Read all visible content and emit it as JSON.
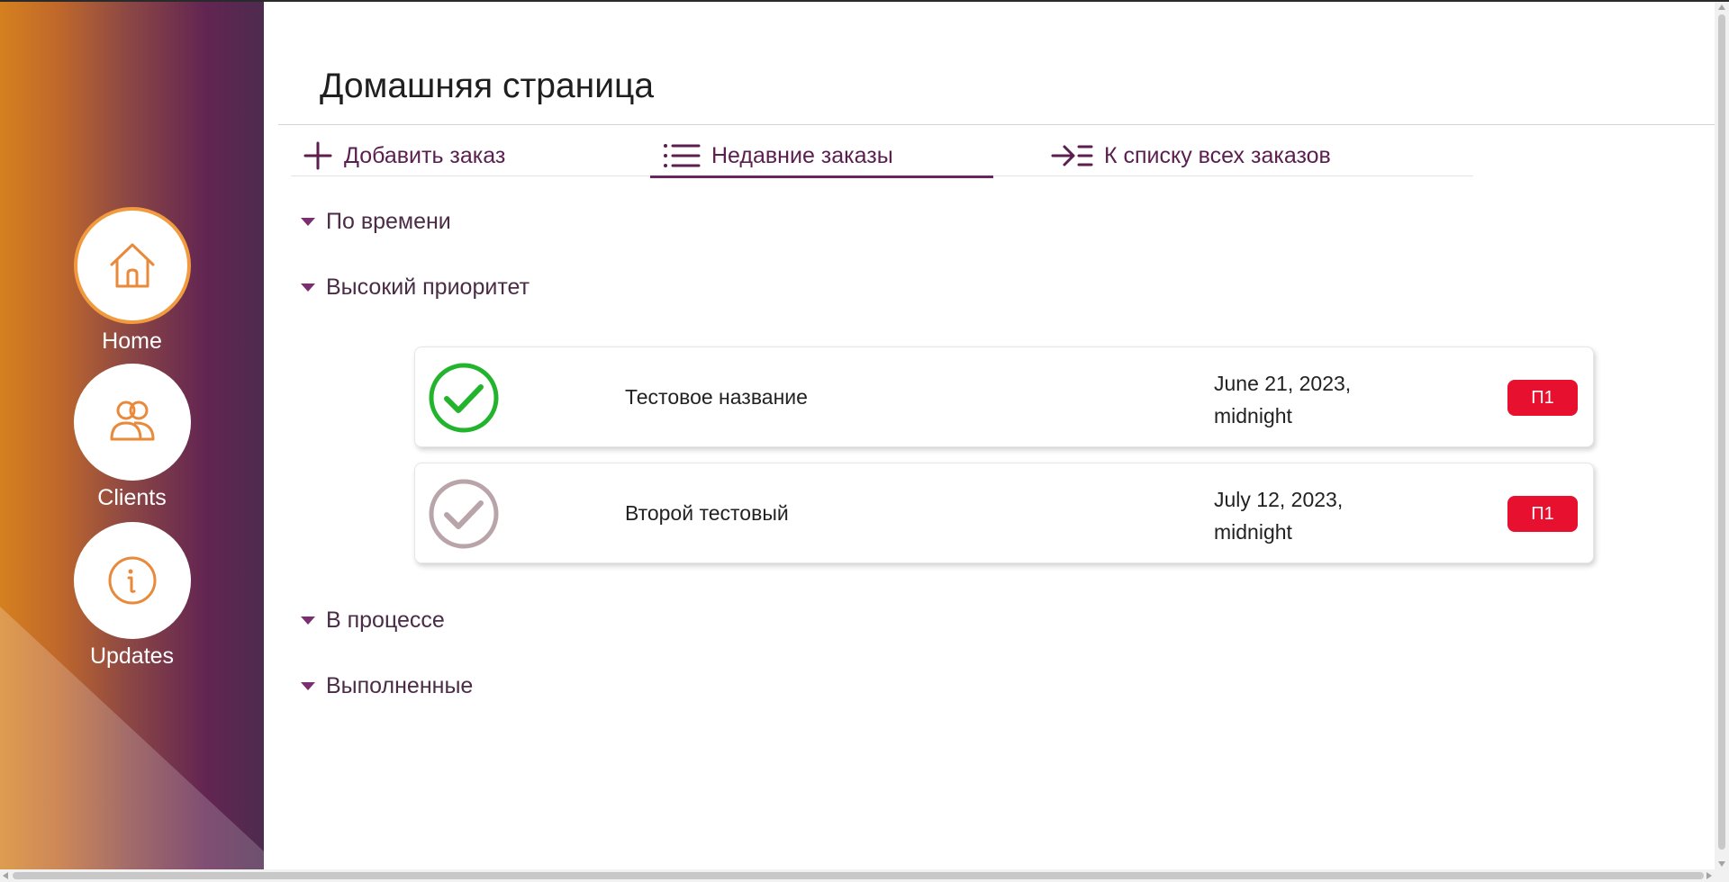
{
  "sidebar": {
    "items": [
      {
        "label": "Home",
        "icon": "home-icon",
        "active": true
      },
      {
        "label": "Clients",
        "icon": "users-icon",
        "active": false
      },
      {
        "label": "Updates",
        "icon": "info-icon",
        "active": false
      }
    ]
  },
  "page": {
    "title": "Домашняя страница"
  },
  "tabs": [
    {
      "label": "Добавить заказ",
      "icon": "plus-icon"
    },
    {
      "label": "Недавние заказы",
      "icon": "list-icon",
      "active": true
    },
    {
      "label": "К списку всех заказов",
      "icon": "arrow-list-icon"
    }
  ],
  "sections": {
    "by_time": "По времени",
    "high_priority": "Высокий приоритет",
    "in_progress": "В процессе",
    "completed": "Выполненные"
  },
  "orders": [
    {
      "name": "Тестовое название",
      "date_line1": "June 21, 2023,",
      "date_line2": "midnight",
      "priority": "П1",
      "done": true
    },
    {
      "name": "Второй тестовый",
      "date_line1": "July 12, 2023,",
      "date_line2": "midnight",
      "priority": "П1",
      "done": false
    }
  ],
  "colors": {
    "accent": "#6a2560",
    "sidebar_orange": "#d5801f",
    "sidebar_purple": "#622552",
    "icon_orange": "#e9893a",
    "check_done": "#23b42d",
    "check_pending": "#b9a4a9",
    "priority_badge": "#e8102f"
  }
}
